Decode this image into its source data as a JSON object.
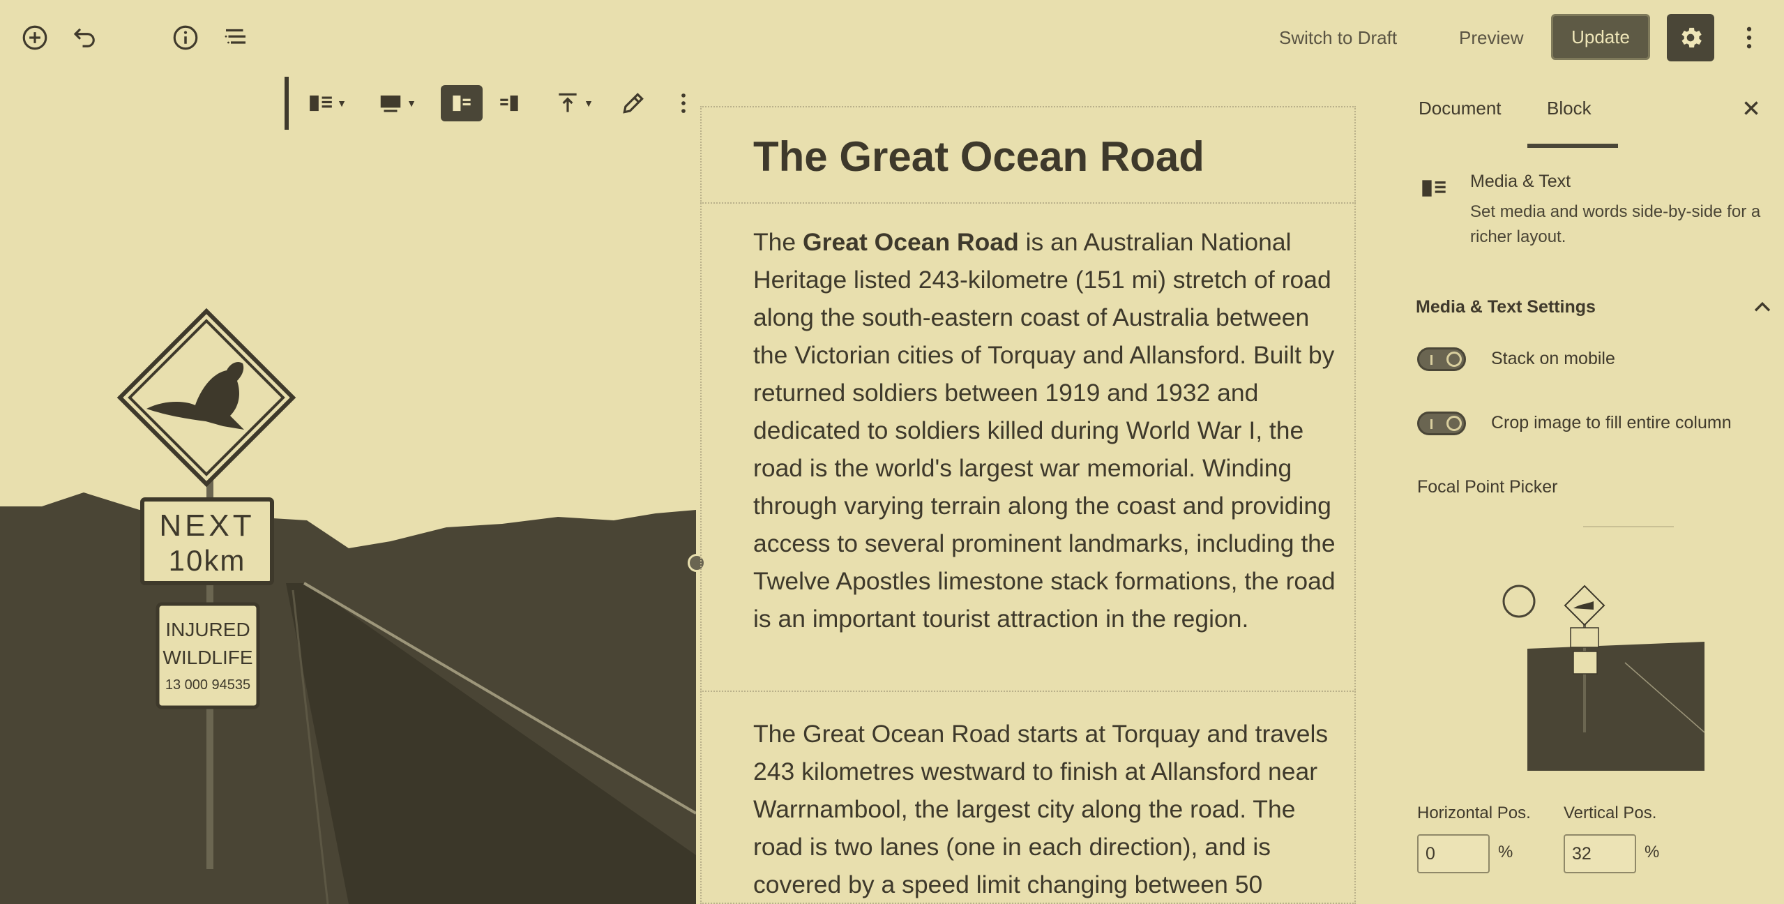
{
  "topbar": {
    "switch_draft": "Switch to Draft",
    "preview": "Preview",
    "update": "Update",
    "icons": [
      "add-block-icon",
      "undo-icon",
      "info-icon",
      "outline-list-icon",
      "gear-icon",
      "more-vertical-icon"
    ]
  },
  "toolbar": {
    "icons": [
      "media-text-block-icon",
      "media-width-icon",
      "media-left-icon",
      "media-right-icon",
      "align-top-icon",
      "edit-pencil-icon",
      "more-vertical-icon"
    ]
  },
  "media": {
    "sign_line1": "NEXT",
    "sign_line2": "10km",
    "sign2_line1": "INJURED",
    "sign2_line2": "WILDLIFE",
    "sign2_line3": "13 000 94535"
  },
  "content": {
    "heading": "The Great Ocean Road",
    "para1_prefix": "The ",
    "para1_bold": "Great Ocean Road",
    "para1_rest": " is an Australian National Heritage listed 243-kilometre (151 mi) stretch of road along the south-eastern coast of Australia between the Victorian cities of Torquay and Allansford. Built by returned soldiers between 1919 and 1932 and dedicated to soldiers killed during World War I, the road is the world's largest war memorial. Winding through varying terrain along the coast and providing access to several prominent landmarks, including the Twelve Apostles limestone stack formations, the road is an important tourist attraction in the region.",
    "para2": "The Great Ocean Road starts at Torquay and travels 243 kilometres westward to finish at Allansford near Warrnambool, the largest city along the road. The road is two lanes (one in each direction), and is covered by a speed limit changing between 50"
  },
  "sidebar": {
    "tab_document": "Document",
    "tab_block": "Block",
    "block_title": "Media & Text",
    "block_desc": "Set media and words side-by-side for a richer layout.",
    "panel_title": "Media & Text Settings",
    "toggle1_label": "Stack on mobile",
    "toggle2_label": "Crop image to fill entire column",
    "focal_label": "Focal Point Picker",
    "horizontal_label": "Horizontal Pos.",
    "vertical_label": "Vertical Pos.",
    "horizontal_value": "0",
    "vertical_value": "32",
    "percent": "%"
  },
  "colors": {
    "background": "#e8dfae",
    "dark": "#4a4637",
    "text": "#3e392b"
  }
}
